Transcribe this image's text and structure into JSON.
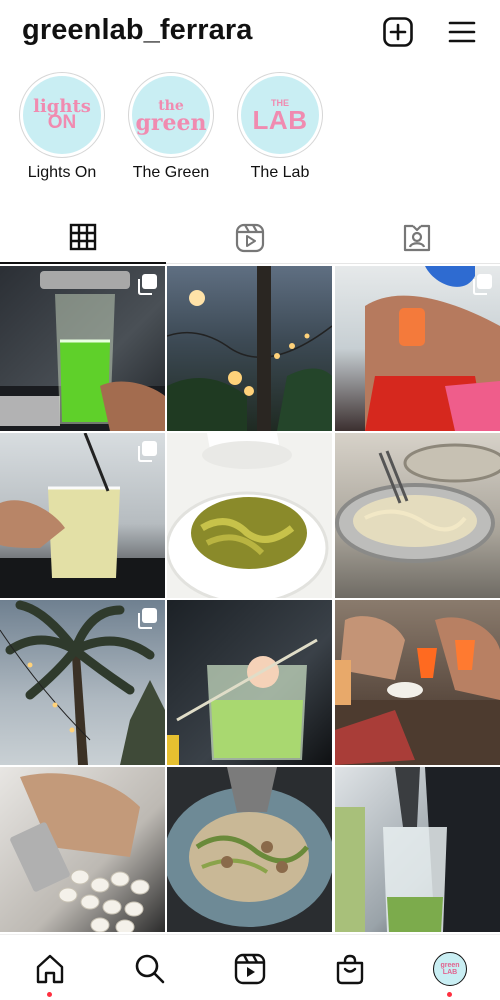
{
  "header": {
    "username": "greenlab_ferrara"
  },
  "highlights": [
    {
      "label": "Lights On",
      "logo_top": "lights",
      "logo_bottom": "ON"
    },
    {
      "label": "The Green",
      "logo_top": "the",
      "logo_bottom": "green"
    },
    {
      "label": "The Lab",
      "logo_top": "THE",
      "logo_bottom": "LAB"
    }
  ],
  "tabs": [
    {
      "icon": "grid-icon",
      "active": true
    },
    {
      "icon": "reels-icon",
      "active": false
    },
    {
      "icon": "tagged-icon",
      "active": false
    }
  ],
  "posts": [
    {
      "subject": "green cocktail being strained",
      "multiple": true
    },
    {
      "subject": "string lights at dusk",
      "multiple": false
    },
    {
      "subject": "spritz in hand",
      "multiple": true
    },
    {
      "subject": "pale cocktail in crystal glass",
      "multiple": true
    },
    {
      "subject": "pasta with green sauce",
      "multiple": false
    },
    {
      "subject": "spaghetti in pan",
      "multiple": false
    },
    {
      "subject": "palm tree and lights",
      "multiple": true
    },
    {
      "subject": "green drink with garnish",
      "multiple": false
    },
    {
      "subject": "friends with spritz at table",
      "multiple": false
    },
    {
      "subject": "hands making gnocchi",
      "multiple": false
    },
    {
      "subject": "plated pasta with zucchini",
      "multiple": false
    },
    {
      "subject": "cocktail poured into glass",
      "multiple": false
    }
  ],
  "nav": {
    "items": [
      "home-icon",
      "search-icon",
      "reels-icon",
      "shop-icon",
      "profile-avatar"
    ],
    "avatar_text_1": "green",
    "avatar_text_2": "LAB"
  },
  "colors": {
    "highlight_bg": "#c9eef3",
    "logo_pink": "#f08bb0",
    "notification_dot": "#ff3040"
  }
}
